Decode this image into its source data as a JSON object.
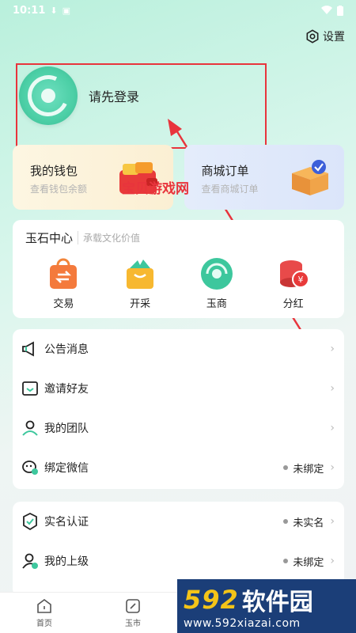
{
  "status_bar": {
    "time": "10:11"
  },
  "header": {
    "settings_label": "设置"
  },
  "profile": {
    "login_prompt": "请先登录"
  },
  "cards": [
    {
      "title": "我的钱包",
      "subtitle": "查看钱包余额"
    },
    {
      "title": "商城订单",
      "subtitle": "查看商城订单"
    }
  ],
  "watermark": "宝贝游戏网",
  "jade_center": {
    "title": "玉石中心",
    "subtitle": "承载文化价值",
    "items": [
      {
        "label": "交易",
        "icon": "bag-swap-icon"
      },
      {
        "label": "开采",
        "icon": "basket-icon"
      },
      {
        "label": "玉商",
        "icon": "jade-disc-icon"
      },
      {
        "label": "分红",
        "icon": "coins-icon"
      }
    ]
  },
  "menu_group_1": [
    {
      "label": "公告消息",
      "icon": "megaphone-icon",
      "status": ""
    },
    {
      "label": "邀请好友",
      "icon": "invite-icon",
      "status": ""
    },
    {
      "label": "我的团队",
      "icon": "team-icon",
      "status": ""
    },
    {
      "label": "绑定微信",
      "icon": "wechat-icon",
      "status": "未绑定"
    }
  ],
  "menu_group_2": [
    {
      "label": "实名认证",
      "icon": "verified-icon",
      "status": "未实名"
    },
    {
      "label": "我的上级",
      "icon": "superior-icon",
      "status": "未绑定"
    }
  ],
  "tabs": [
    {
      "label": "首页",
      "icon": "home-icon"
    },
    {
      "label": "玉市",
      "icon": "market-icon"
    }
  ],
  "brand": {
    "number": "592",
    "name": "软件园",
    "url": "www.592xiazai.com"
  },
  "colors": {
    "accent": "#4ccfa6",
    "annotation": "#e8343c",
    "brand_bg": "#1b3e78"
  }
}
